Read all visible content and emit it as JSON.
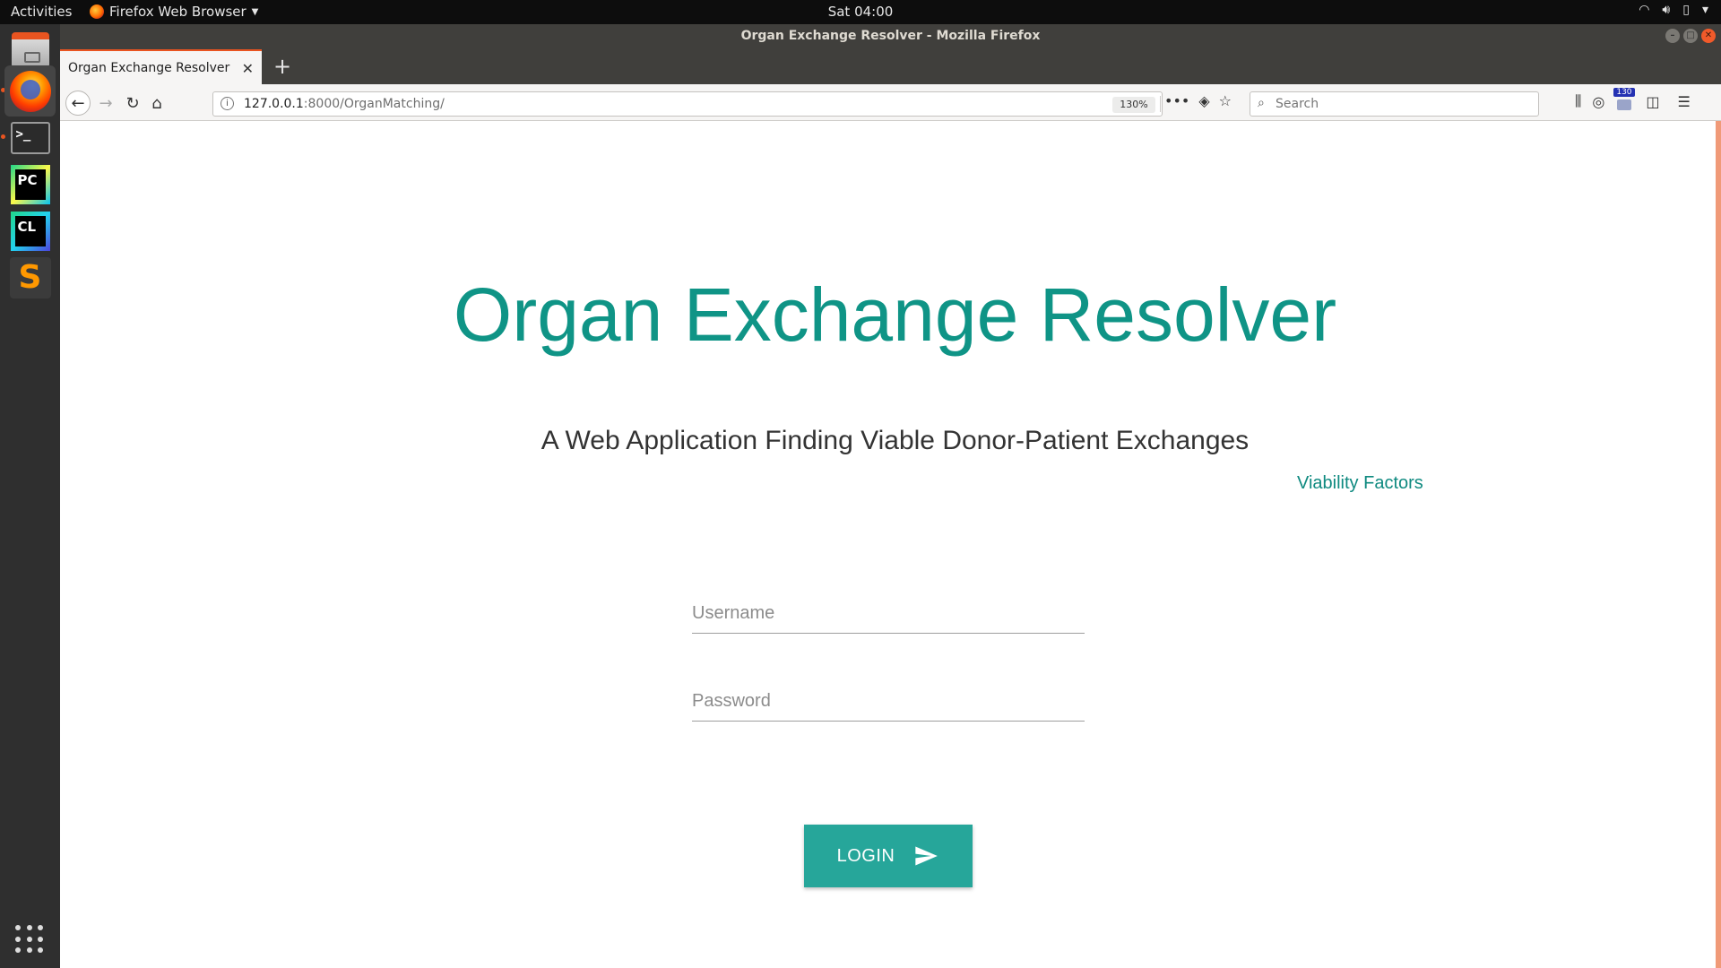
{
  "topbar": {
    "activities": "Activities",
    "app_name": "Firefox Web Browser",
    "clock": "Sat 04:00"
  },
  "window": {
    "title": "Organ Exchange Resolver - Mozilla Firefox"
  },
  "tabs": [
    {
      "label": "Organ Exchange Resolver",
      "active": true
    }
  ],
  "navbar": {
    "url_host": "127.0.0.1",
    "url_path": ":8000/OrganMatching/",
    "zoom": "130%",
    "search_placeholder": "Search",
    "badge_count": "130"
  },
  "page": {
    "title": "Organ Exchange Resolver",
    "subtitle": "A Web Application Finding Viable Donor-Patient Exchanges",
    "link_label": "Viability Factors",
    "username_placeholder": "Username",
    "password_placeholder": "Password",
    "login_label": "LOGIN"
  },
  "colors": {
    "accent": "#26a69a",
    "title_teal": "#0f9486",
    "ubuntu_orange": "#e95420"
  },
  "dock": {
    "apps": [
      "files-icon",
      "firefox-icon",
      "terminal-icon",
      "pycharm-icon",
      "clion-icon",
      "sublime-text-icon",
      "show-applications-icon"
    ]
  }
}
